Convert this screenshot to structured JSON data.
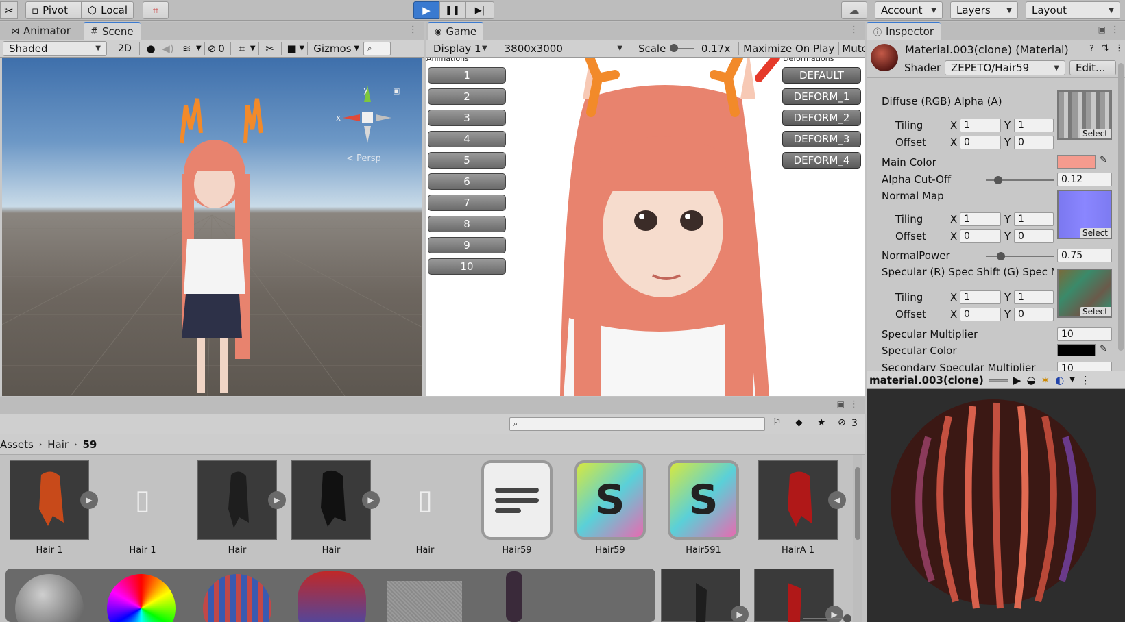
{
  "toolbar": {
    "pivot_label": "Pivot",
    "local_label": "Local",
    "account_label": "Account",
    "layers_label": "Layers",
    "layout_label": "Layout"
  },
  "scene": {
    "tab_animator": "Animator",
    "tab_scene": "Scene",
    "shading_mode": "Shaded",
    "mode_2d": "2D",
    "hidden_count": "0",
    "gizmos_label": "Gizmos",
    "persp_label": "< Persp",
    "axis_x": "x",
    "axis_y": "y"
  },
  "game": {
    "tab_label": "Game",
    "display": "Display 1",
    "resolution": "3800x3000",
    "scale_label": "Scale",
    "scale_value": "0.17x",
    "maximize_label": "Maximize On Play",
    "mute_label": "Mute",
    "animations_header": "Animations",
    "deformations_header": "Deformations",
    "animation_buttons": [
      "1",
      "2",
      "3",
      "4",
      "5",
      "6",
      "7",
      "8",
      "9",
      "10"
    ],
    "deform_buttons": [
      "DEFAULT",
      "DEFORM_1",
      "DEFORM_2",
      "DEFORM_3",
      "DEFORM_4"
    ]
  },
  "inspector": {
    "tab_label": "Inspector",
    "title": "Material.003(clone) (Material)",
    "shader_label": "Shader",
    "shader_value": "ZEPETO/Hair59",
    "edit_label": "Edit...",
    "diffuse_label": "Diffuse (RGB) Alpha (A)",
    "tiling_label": "Tiling",
    "offset_label": "Offset",
    "x_label": "X",
    "y_label": "Y",
    "diffuse_tiling_x": "1",
    "diffuse_tiling_y": "1",
    "diffuse_offset_x": "0",
    "diffuse_offset_y": "0",
    "select_label": "Select",
    "main_color_label": "Main Color",
    "main_color": "#f59b8e",
    "alpha_cutoff_label": "Alpha Cut-Off",
    "alpha_cutoff_value": "0.12",
    "alpha_cutoff_level": 0.12,
    "normal_map_label": "Normal Map",
    "normal_tiling_x": "1",
    "normal_tiling_y": "1",
    "normal_offset_x": "0",
    "normal_offset_y": "0",
    "normal_power_label": "NormalPower",
    "normal_power_value": "0.75",
    "normal_power_level": 0.2,
    "specular_label": "Specular (R) Spec Shift (G) Spec M",
    "spec_tiling_x": "1",
    "spec_tiling_y": "1",
    "spec_offset_x": "0",
    "spec_offset_y": "0",
    "spec_multiplier_label": "Specular Multiplier",
    "spec_multiplier_value": "10",
    "spec_color_label": "Specular Color",
    "spec_color": "#000000",
    "secondary_label": "Secondary Specular Multiplier",
    "secondary_value": "10"
  },
  "preview": {
    "title": "material.003(clone)"
  },
  "project": {
    "hidden_count": "3",
    "breadcrumb": [
      "Assets",
      "Hair",
      "59"
    ],
    "assets": [
      {
        "label": "Hair 1"
      },
      {
        "label": "Hair 1"
      },
      {
        "label": "Hair"
      },
      {
        "label": "Hair"
      },
      {
        "label": "Hair"
      },
      {
        "label": "Hair59"
      },
      {
        "label": "Hair59"
      },
      {
        "label": "Hair591"
      },
      {
        "label": "HairA 1"
      }
    ]
  },
  "colors": {
    "accent": "#3a7ad0",
    "panel": "#c8c8c8",
    "hair": "#e8836e"
  }
}
